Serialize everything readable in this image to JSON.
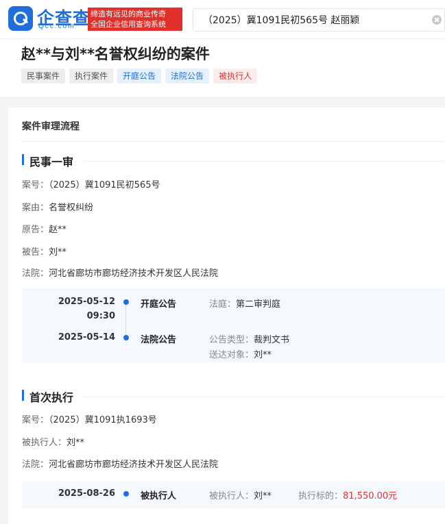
{
  "header": {
    "logo_cn": "企查查",
    "logo_en": "Qcc.com",
    "slogan_line1": "缔造有远见的商业传奇",
    "slogan_line2": "全国企业信用查询系统",
    "search_value": "（2025）冀1091民初565号 赵丽颖"
  },
  "page": {
    "title": "赵**与刘**名誉权纠纷的案件",
    "tags": [
      "民事案件",
      "执行案件",
      "开庭公告",
      "法院公告",
      "被执行人"
    ]
  },
  "process": {
    "title": "案件审理流程",
    "first_trial": {
      "heading": "民事一审",
      "case_no_label": "案号：",
      "case_no": "（2025）冀1091民初565号",
      "cause_label": "案由：",
      "cause": "名誉权纠纷",
      "plaintiff_label": "原告：",
      "plaintiff": "赵**",
      "defendant_label": "被告：",
      "defendant": "刘**",
      "court_label": "法院：",
      "court": "河北省廊坊市廊坊经济技术开发区人民法院",
      "events": [
        {
          "date": "2025-05-12",
          "time": "09:30",
          "type": "开庭公告",
          "detail1_label": "法庭：",
          "detail1_value": "第二审判庭"
        },
        {
          "date": "2025-05-14",
          "type": "法院公告",
          "detail1_label": "公告类型：",
          "detail1_value": "裁判文书",
          "detail2_label": "送达对象：",
          "detail2_value": "刘**"
        }
      ]
    },
    "execution": {
      "heading": "首次执行",
      "case_no_label": "案号：",
      "case_no": "（2025）冀1091执1693号",
      "executed_label": "被执行人：",
      "executed": "刘**",
      "court_label": "法院：",
      "court": "河北省廊坊市廊坊经济技术开发区人民法院",
      "event": {
        "date": "2025-08-26",
        "type": "被执行人",
        "detail1_label": "被执行人：",
        "detail1_value": "刘**",
        "detail2_label": "执行标的：",
        "detail2_value": "81,550.00元"
      }
    }
  },
  "colors": {
    "brand_blue": "#1e6fd9",
    "slogan_red": "#e0302c",
    "amount_red": "#e0302c"
  }
}
